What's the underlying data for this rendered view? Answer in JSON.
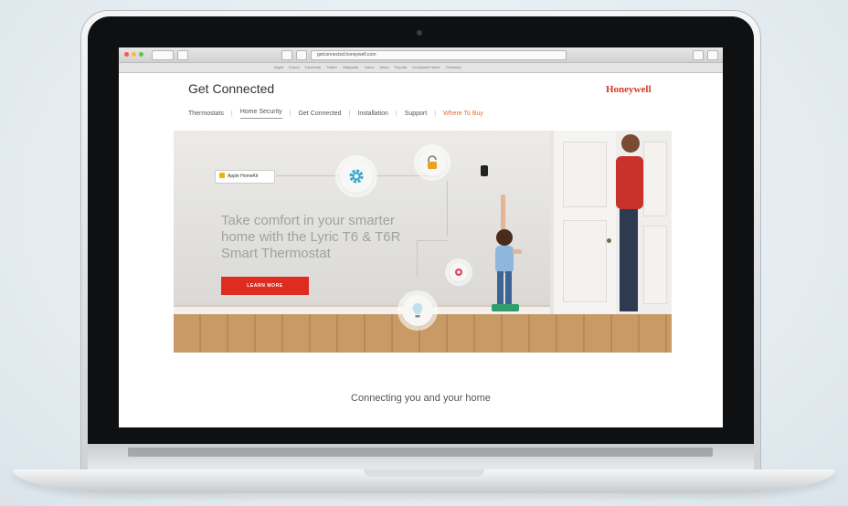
{
  "browser": {
    "url": "getconnected.honeywell.com",
    "bookmarks": [
      "Apple",
      "iCloud",
      "Facebook",
      "Twitter",
      "Wikipedia",
      "Yahoo",
      "News",
      "Popular",
      "Honeywell Home",
      "Checkout"
    ]
  },
  "header": {
    "site_title": "Get Connected",
    "logo": "Honeywell",
    "nav": [
      {
        "label": "Thermostats"
      },
      {
        "label": "Home Security"
      },
      {
        "label": "Get Connected"
      },
      {
        "label": "Installation"
      },
      {
        "label": "Support"
      },
      {
        "label": "Where To Buy"
      }
    ]
  },
  "hero": {
    "badge_label": "Apple HomeKit",
    "headline": "Take comfort in your smarter home with the Lyric T6 & T6R Smart Thermostat",
    "cta_label": "LEARN MORE"
  },
  "main": {
    "tagline": "Connecting you and your home"
  },
  "colors": {
    "accent_red": "#e02b20",
    "brand_red": "#d43826",
    "nav_highlight": "#e76a2a",
    "icon_teal": "#3aa7c9",
    "icon_amber": "#e7a323",
    "icon_pink": "#e2435a"
  }
}
